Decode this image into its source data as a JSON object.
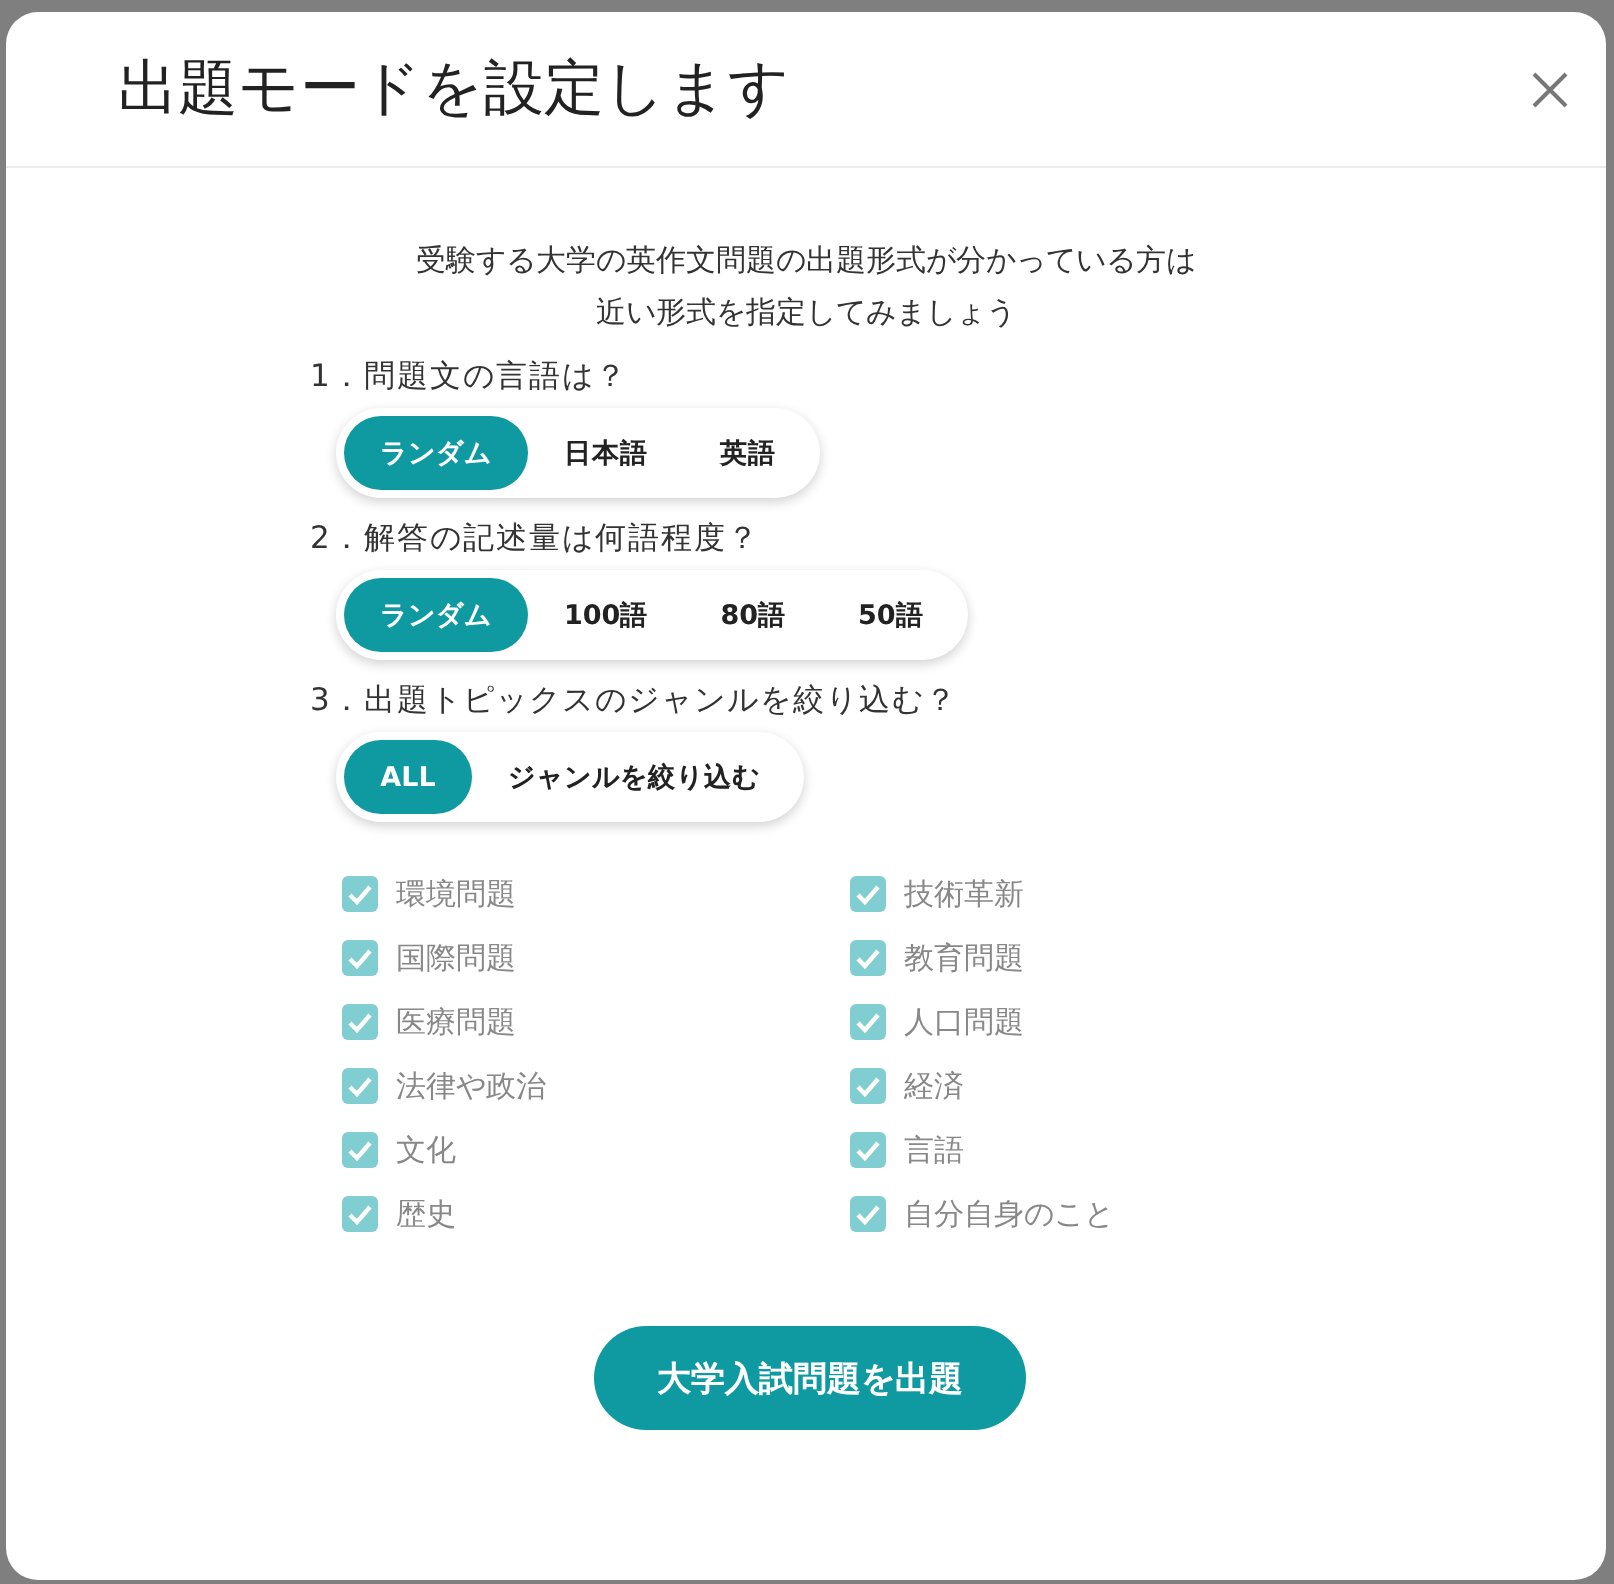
{
  "dialog": {
    "title": "出題モードを設定します",
    "intro": [
      "受験する大学の英作文問題の出題形式が分かっている方は",
      "近い形式を指定してみましょう"
    ],
    "questions": [
      {
        "label": "1．問題文の言語は？",
        "options": [
          {
            "label": "ランダム",
            "selected": true
          },
          {
            "label": "日本語",
            "selected": false
          },
          {
            "label": "英語",
            "selected": false
          }
        ]
      },
      {
        "label": "2．解答の記述量は何語程度？",
        "options": [
          {
            "label": "ランダム",
            "selected": true
          },
          {
            "label": "100語",
            "selected": false
          },
          {
            "label": "80語",
            "selected": false
          },
          {
            "label": "50語",
            "selected": false
          }
        ]
      },
      {
        "label": "3．出題トピックスのジャンルを絞り込む？",
        "options": [
          {
            "label": "ALL",
            "selected": true
          },
          {
            "label": "ジャンルを絞り込む",
            "selected": false
          }
        ]
      }
    ],
    "genres": [
      {
        "label": "環境問題",
        "checked": true,
        "disabled": true
      },
      {
        "label": "技術革新",
        "checked": true,
        "disabled": true
      },
      {
        "label": "国際問題",
        "checked": true,
        "disabled": true
      },
      {
        "label": "教育問題",
        "checked": true,
        "disabled": true
      },
      {
        "label": "医療問題",
        "checked": true,
        "disabled": true
      },
      {
        "label": "人口問題",
        "checked": true,
        "disabled": true
      },
      {
        "label": "法律や政治",
        "checked": true,
        "disabled": true
      },
      {
        "label": "経済",
        "checked": true,
        "disabled": true
      },
      {
        "label": "文化",
        "checked": true,
        "disabled": true
      },
      {
        "label": "言語",
        "checked": true,
        "disabled": true
      },
      {
        "label": "歴史",
        "checked": true,
        "disabled": true
      },
      {
        "label": "自分自身のこと",
        "checked": true,
        "disabled": true
      }
    ],
    "submit": "大学入試問題を出題"
  }
}
